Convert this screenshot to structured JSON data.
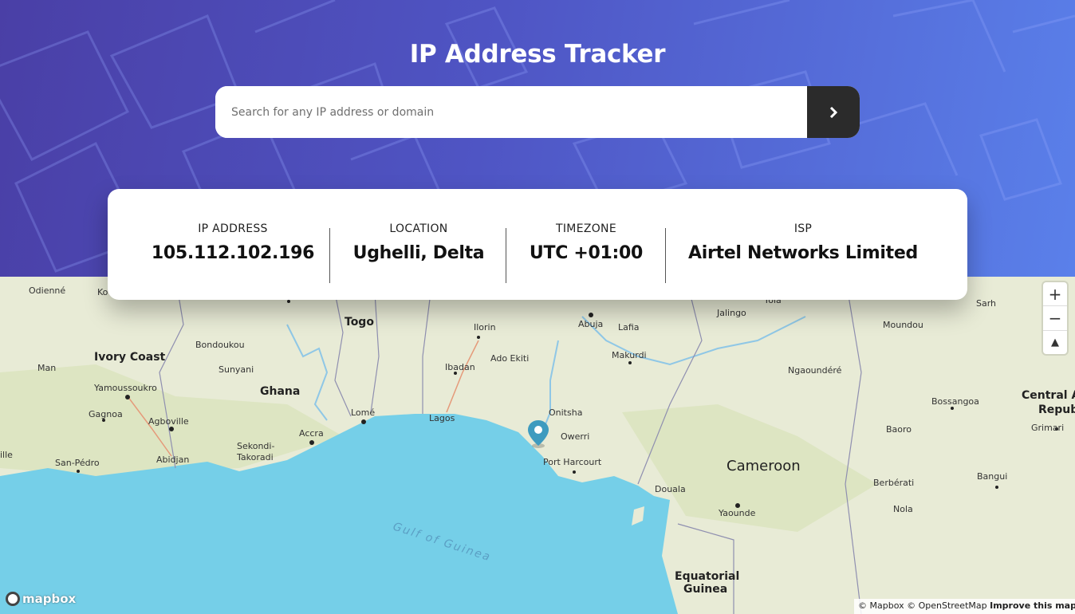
{
  "header": {
    "title": "IP Address Tracker"
  },
  "search": {
    "placeholder": "Search for any IP address or domain",
    "value": "",
    "submit_icon": "chevron-right-icon"
  },
  "info": {
    "ip_label": "IP ADDRESS",
    "ip_value": "105.112.102.196",
    "location_label": "LOCATION",
    "location_value": "Ughelli, Delta",
    "timezone_label": "TIMEZONE",
    "timezone_value": "UTC +01:00",
    "isp_label": "ISP",
    "isp_value": "Airtel Networks Limited"
  },
  "map": {
    "labels": {
      "odienne": "Odienné",
      "ko": "Ko",
      "togo": "Togo",
      "ilorin": "Ilorin",
      "abuja": "Abuja",
      "lafia": "Lafia",
      "jalingo": "Jalingo",
      "yola": "Yola",
      "sarh": "Sarh",
      "moundou": "Moundou",
      "ivory_coast": "Ivory Coast",
      "bondoukou": "Bondoukou",
      "man": "Man",
      "sunyani": "Sunyani",
      "ado_ekiti": "Ado Ekiti",
      "makurdi": "Makurdi",
      "ibadan": "Ibadan",
      "ngaoundere": "Ngaoundéré",
      "yamoussoukro": "Yamoussoukro",
      "ghana": "Ghana",
      "bossangoa": "Bossangoa",
      "central_afr": "Central Afr",
      "repub": "Repub",
      "gagnoa": "Gagnoa",
      "agboville": "Agboville",
      "lome": "Lomé",
      "lagos": "Lagos",
      "onitsha": "Onitsha",
      "owerri": "Owerri",
      "baoro": "Baoro",
      "grimari": "Grimari",
      "sekondi": "Sekondi-",
      "takoradi": "Takoradi",
      "accra": "Accra",
      "abidjan": "Abidjan",
      "san_pedro": "San-Pédro",
      "ille": "ille",
      "port_harcourt": "Port Harcourt",
      "cameroon": "Cameroon",
      "douala": "Douala",
      "berberati": "Berbérati",
      "bangui": "Bangui",
      "yaounde": "Yaounde",
      "nola": "Nola",
      "gulf": "Gulf of Guinea",
      "equatorial": "Equatorial",
      "guinea": "Guinea"
    },
    "zoom_in": "+",
    "zoom_out": "−",
    "compass": "▲",
    "logo_text": "mapbox",
    "attribution": "© Mapbox © OpenStreetMap",
    "improve": "Improve this map",
    "marker_icon": "location-pin-icon",
    "colors": {
      "land": "#e8ebd6",
      "sea": "#75cfe8",
      "marker": "#3e9bbf"
    }
  }
}
